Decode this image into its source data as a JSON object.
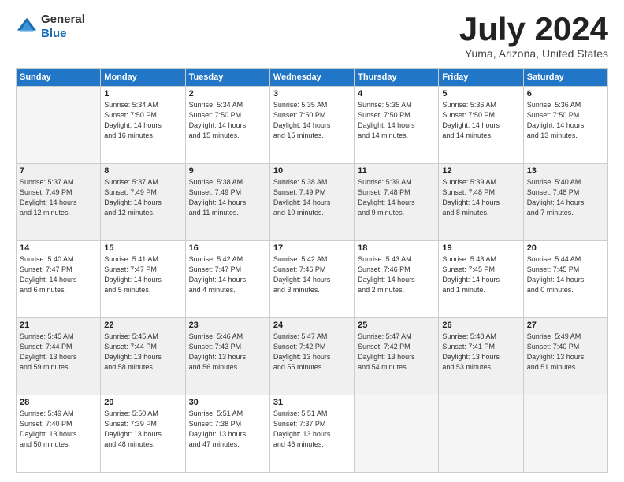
{
  "header": {
    "logo_general": "General",
    "logo_blue": "Blue",
    "month_title": "July 2024",
    "subtitle": "Yuma, Arizona, United States"
  },
  "weekdays": [
    "Sunday",
    "Monday",
    "Tuesday",
    "Wednesday",
    "Thursday",
    "Friday",
    "Saturday"
  ],
  "weeks": [
    [
      {
        "num": "",
        "info": ""
      },
      {
        "num": "1",
        "info": "Sunrise: 5:34 AM\nSunset: 7:50 PM\nDaylight: 14 hours\nand 16 minutes."
      },
      {
        "num": "2",
        "info": "Sunrise: 5:34 AM\nSunset: 7:50 PM\nDaylight: 14 hours\nand 15 minutes."
      },
      {
        "num": "3",
        "info": "Sunrise: 5:35 AM\nSunset: 7:50 PM\nDaylight: 14 hours\nand 15 minutes."
      },
      {
        "num": "4",
        "info": "Sunrise: 5:35 AM\nSunset: 7:50 PM\nDaylight: 14 hours\nand 14 minutes."
      },
      {
        "num": "5",
        "info": "Sunrise: 5:36 AM\nSunset: 7:50 PM\nDaylight: 14 hours\nand 14 minutes."
      },
      {
        "num": "6",
        "info": "Sunrise: 5:36 AM\nSunset: 7:50 PM\nDaylight: 14 hours\nand 13 minutes."
      }
    ],
    [
      {
        "num": "7",
        "info": "Sunrise: 5:37 AM\nSunset: 7:49 PM\nDaylight: 14 hours\nand 12 minutes."
      },
      {
        "num": "8",
        "info": "Sunrise: 5:37 AM\nSunset: 7:49 PM\nDaylight: 14 hours\nand 12 minutes."
      },
      {
        "num": "9",
        "info": "Sunrise: 5:38 AM\nSunset: 7:49 PM\nDaylight: 14 hours\nand 11 minutes."
      },
      {
        "num": "10",
        "info": "Sunrise: 5:38 AM\nSunset: 7:49 PM\nDaylight: 14 hours\nand 10 minutes."
      },
      {
        "num": "11",
        "info": "Sunrise: 5:39 AM\nSunset: 7:48 PM\nDaylight: 14 hours\nand 9 minutes."
      },
      {
        "num": "12",
        "info": "Sunrise: 5:39 AM\nSunset: 7:48 PM\nDaylight: 14 hours\nand 8 minutes."
      },
      {
        "num": "13",
        "info": "Sunrise: 5:40 AM\nSunset: 7:48 PM\nDaylight: 14 hours\nand 7 minutes."
      }
    ],
    [
      {
        "num": "14",
        "info": "Sunrise: 5:40 AM\nSunset: 7:47 PM\nDaylight: 14 hours\nand 6 minutes."
      },
      {
        "num": "15",
        "info": "Sunrise: 5:41 AM\nSunset: 7:47 PM\nDaylight: 14 hours\nand 5 minutes."
      },
      {
        "num": "16",
        "info": "Sunrise: 5:42 AM\nSunset: 7:47 PM\nDaylight: 14 hours\nand 4 minutes."
      },
      {
        "num": "17",
        "info": "Sunrise: 5:42 AM\nSunset: 7:46 PM\nDaylight: 14 hours\nand 3 minutes."
      },
      {
        "num": "18",
        "info": "Sunrise: 5:43 AM\nSunset: 7:46 PM\nDaylight: 14 hours\nand 2 minutes."
      },
      {
        "num": "19",
        "info": "Sunrise: 5:43 AM\nSunset: 7:45 PM\nDaylight: 14 hours\nand 1 minute."
      },
      {
        "num": "20",
        "info": "Sunrise: 5:44 AM\nSunset: 7:45 PM\nDaylight: 14 hours\nand 0 minutes."
      }
    ],
    [
      {
        "num": "21",
        "info": "Sunrise: 5:45 AM\nSunset: 7:44 PM\nDaylight: 13 hours\nand 59 minutes."
      },
      {
        "num": "22",
        "info": "Sunrise: 5:45 AM\nSunset: 7:44 PM\nDaylight: 13 hours\nand 58 minutes."
      },
      {
        "num": "23",
        "info": "Sunrise: 5:46 AM\nSunset: 7:43 PM\nDaylight: 13 hours\nand 56 minutes."
      },
      {
        "num": "24",
        "info": "Sunrise: 5:47 AM\nSunset: 7:42 PM\nDaylight: 13 hours\nand 55 minutes."
      },
      {
        "num": "25",
        "info": "Sunrise: 5:47 AM\nSunset: 7:42 PM\nDaylight: 13 hours\nand 54 minutes."
      },
      {
        "num": "26",
        "info": "Sunrise: 5:48 AM\nSunset: 7:41 PM\nDaylight: 13 hours\nand 53 minutes."
      },
      {
        "num": "27",
        "info": "Sunrise: 5:49 AM\nSunset: 7:40 PM\nDaylight: 13 hours\nand 51 minutes."
      }
    ],
    [
      {
        "num": "28",
        "info": "Sunrise: 5:49 AM\nSunset: 7:40 PM\nDaylight: 13 hours\nand 50 minutes."
      },
      {
        "num": "29",
        "info": "Sunrise: 5:50 AM\nSunset: 7:39 PM\nDaylight: 13 hours\nand 48 minutes."
      },
      {
        "num": "30",
        "info": "Sunrise: 5:51 AM\nSunset: 7:38 PM\nDaylight: 13 hours\nand 47 minutes."
      },
      {
        "num": "31",
        "info": "Sunrise: 5:51 AM\nSunset: 7:37 PM\nDaylight: 13 hours\nand 46 minutes."
      },
      {
        "num": "",
        "info": ""
      },
      {
        "num": "",
        "info": ""
      },
      {
        "num": "",
        "info": ""
      }
    ]
  ]
}
